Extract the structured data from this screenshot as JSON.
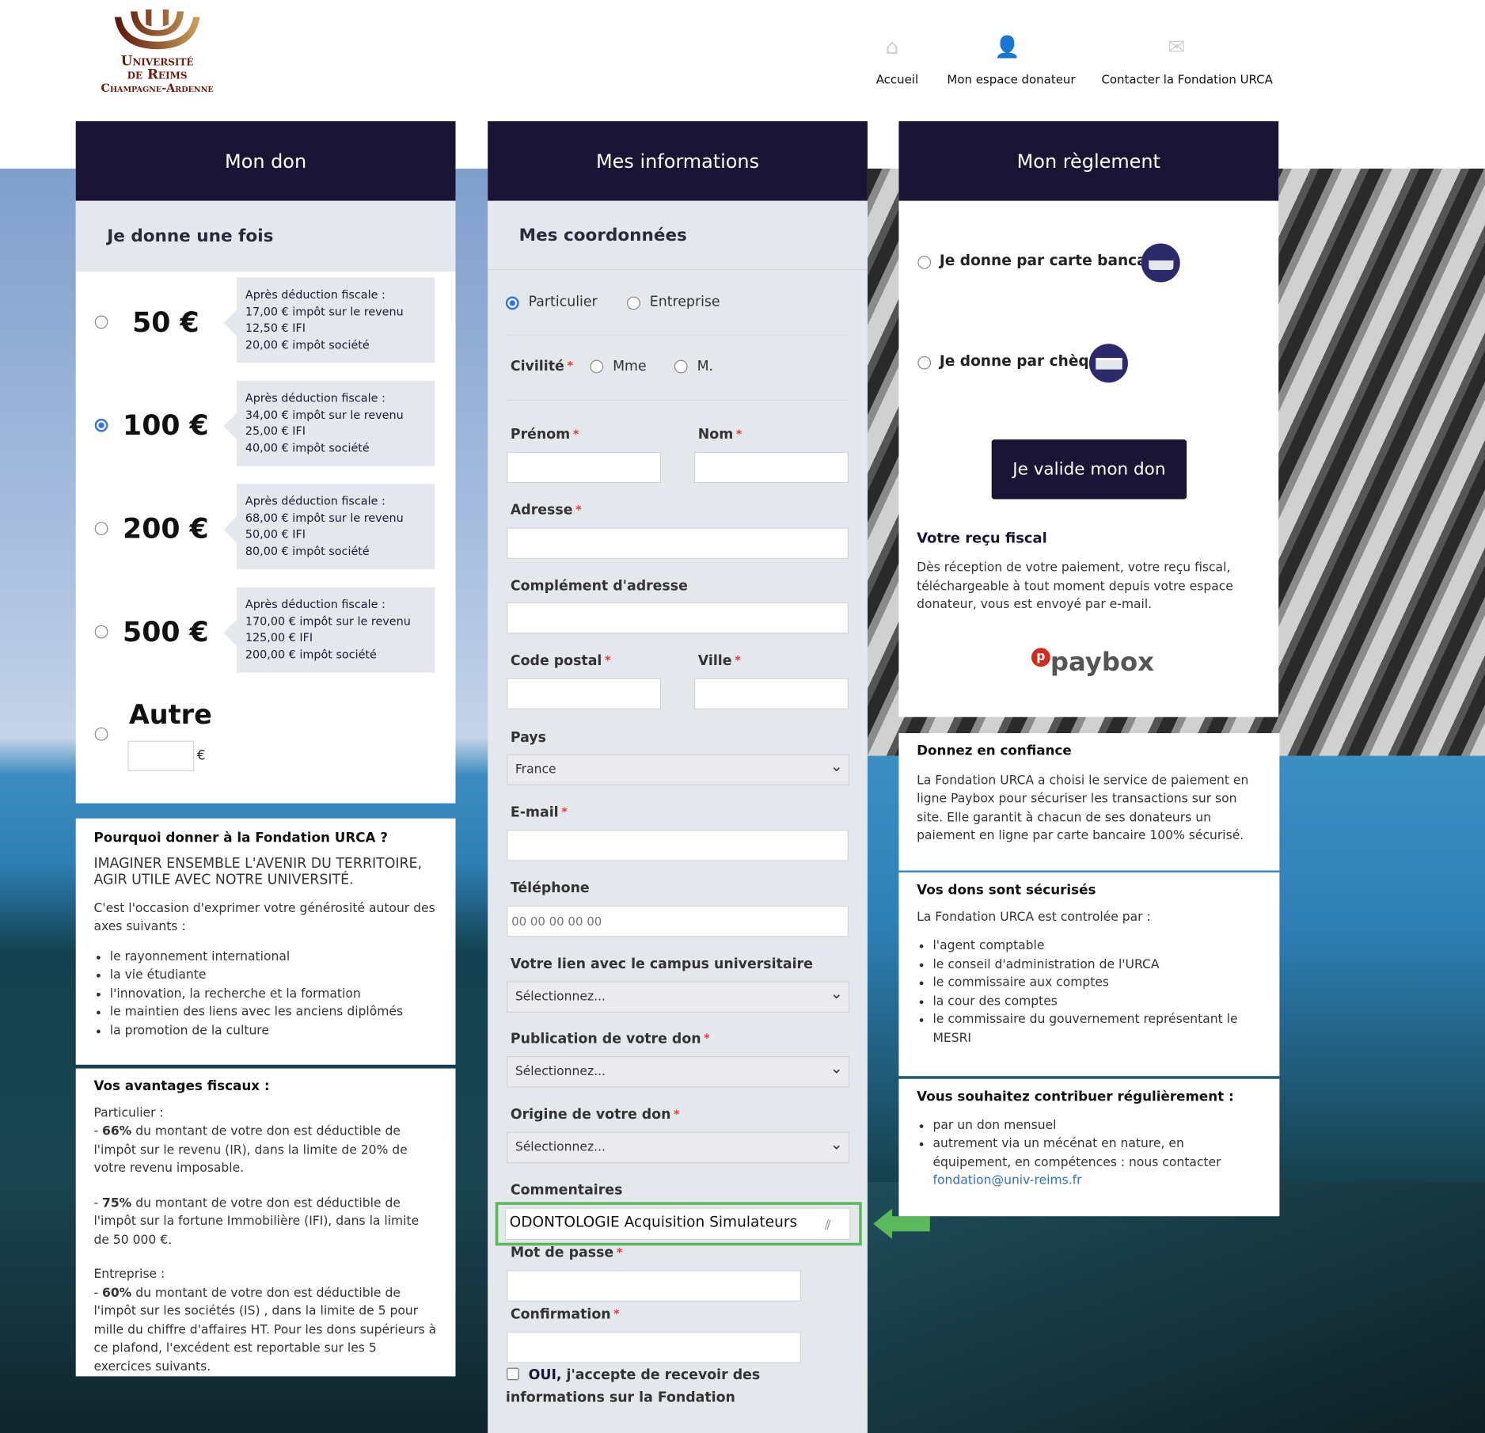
{
  "logo": {
    "line1": "Université",
    "line2": "de Reims",
    "line3": "Champagne-Ardenne"
  },
  "nav": [
    {
      "label": "Accueil",
      "icon": "home-icon"
    },
    {
      "label": "Mon espace donateur",
      "icon": "user-check-icon"
    },
    {
      "label": "Contacter la Fondation URCA",
      "icon": "envelope-icon"
    }
  ],
  "don": {
    "title": "Mon don",
    "subtitle": "Je donne une fois",
    "tip_heading": "Après déduction fiscale :",
    "amounts": [
      {
        "label": "50 €",
        "selected": false,
        "lines": [
          "17,00 € impôt sur le revenu",
          "12,50 € IFI",
          "20,00 € impôt société"
        ]
      },
      {
        "label": "100 €",
        "selected": true,
        "lines": [
          "34,00 € impôt sur le revenu",
          "25,00 € IFI",
          "40,00 € impôt société"
        ]
      },
      {
        "label": "200 €",
        "selected": false,
        "lines": [
          "68,00 € impôt sur le revenu",
          "50,00 € IFI",
          "80,00 € impôt société"
        ]
      },
      {
        "label": "500 €",
        "selected": false,
        "lines": [
          "170,00 € impôt sur le revenu",
          "125,00 € IFI",
          "200,00 € impôt société"
        ]
      }
    ],
    "other_label": "Autre",
    "other_currency": "€"
  },
  "why": {
    "title": "Pourquoi donner à la Fondation URCA ?",
    "slogan": "IMAGINER ENSEMBLE L'AVENIR DU TERRITOIRE, AGIR UTILE AVEC NOTRE UNIVERSITÉ.",
    "intro": "C'est l'occasion d'exprimer votre générosité autour des axes suivants :",
    "items": [
      "le rayonnement international",
      "la vie étudiante",
      "l'innovation, la recherche et la formation",
      "le maintien des liens avec les anciens diplômés",
      "la promotion de la culture"
    ]
  },
  "tax": {
    "title": "Vos avantages fiscaux :",
    "part_label": "Particulier :",
    "p1_pct": "66%",
    "p1": " du montant de votre don est déductible de l'impôt sur le revenu (IR), dans la limite de 20% de votre revenu imposable.",
    "p2_pct": "75%",
    "p2": " du montant de votre don est déductible de l'impôt sur la fortune Immobilière (IFI), dans la limite de 50 000 €.",
    "ent_label": "Entreprise :",
    "e1_pct": "60%",
    "e1": " du montant de votre don est déductible de l'impôt sur les sociétés (IS) , dans la limite de 5 pour mille du chiffre d'affaires HT. Pour les dons supérieurs à ce plafond, l'excédent est reportable sur les 5 exercices suivants."
  },
  "info": {
    "title": "Mes informations",
    "subtitle": "Mes coordonnées",
    "type_options": [
      "Particulier",
      "Entreprise"
    ],
    "civilite": "Civilité",
    "civ_options": [
      "Mme",
      "M."
    ],
    "prenom": "Prénom",
    "nom": "Nom",
    "adresse": "Adresse",
    "complement": "Complément d'adresse",
    "cp": "Code postal",
    "ville": "Ville",
    "pays": "Pays",
    "pays_value": "France",
    "email": "E-mail",
    "tel": "Téléphone",
    "tel_placeholder": "00 00 00 00 00",
    "lien": "Votre lien avec le campus universitaire",
    "select_placeholder": "Sélectionnez...",
    "publication": "Publication de votre don",
    "origine": "Origine de votre don",
    "commentaires": "Commentaires",
    "commentaires_value": "ODONTOLOGIE Acquisition Simulateurs",
    "mdp": "Mot de passe",
    "confirmation": "Confirmation",
    "optin_bold": "OUI,",
    "optin": " j'accepte de recevoir des informations sur la Fondation",
    "required": "*"
  },
  "reglement": {
    "title": "Mon règlement",
    "card": "Je donne par carte bancaire",
    "cheque": "Je donne par chèque",
    "validate": "Je valide mon don",
    "recu_title": "Votre reçu fiscal",
    "recu_text": "Dès réception de votre paiement, votre reçu fiscal, téléchargeable à tout moment depuis votre espace donateur, vous est envoyé par e-mail.",
    "paybox": "paybox"
  },
  "confiance": {
    "title": "Donnez en confiance",
    "text": "La Fondation URCA a choisi le service de paiement en ligne Paybox pour sécuriser les transactions sur son site. Elle garantit à chacun de ses donateurs un paiement en ligne par carte bancaire 100% sécurisé."
  },
  "secure": {
    "title": "Vos dons sont sécurisés",
    "intro": "La Fondation URCA est controlée par :",
    "items": [
      "l'agent comptable",
      "le conseil d'administration de l'URCA",
      "le commissaire aux comptes",
      "la cour des comptes",
      "le commissaire du gouvernement représentant le MESRI"
    ]
  },
  "regular": {
    "title": "Vous souhaitez contribuer régulièrement :",
    "item1": "par un don mensuel",
    "item2": "autrement via un mécénat en nature, en équipement, en compétences : nous contacter ",
    "email": "fondation@univ-reims.fr"
  },
  "colors": {
    "navy": "#1a1535",
    "highlight": "#5cb85c",
    "accent": "#2f72e8"
  }
}
